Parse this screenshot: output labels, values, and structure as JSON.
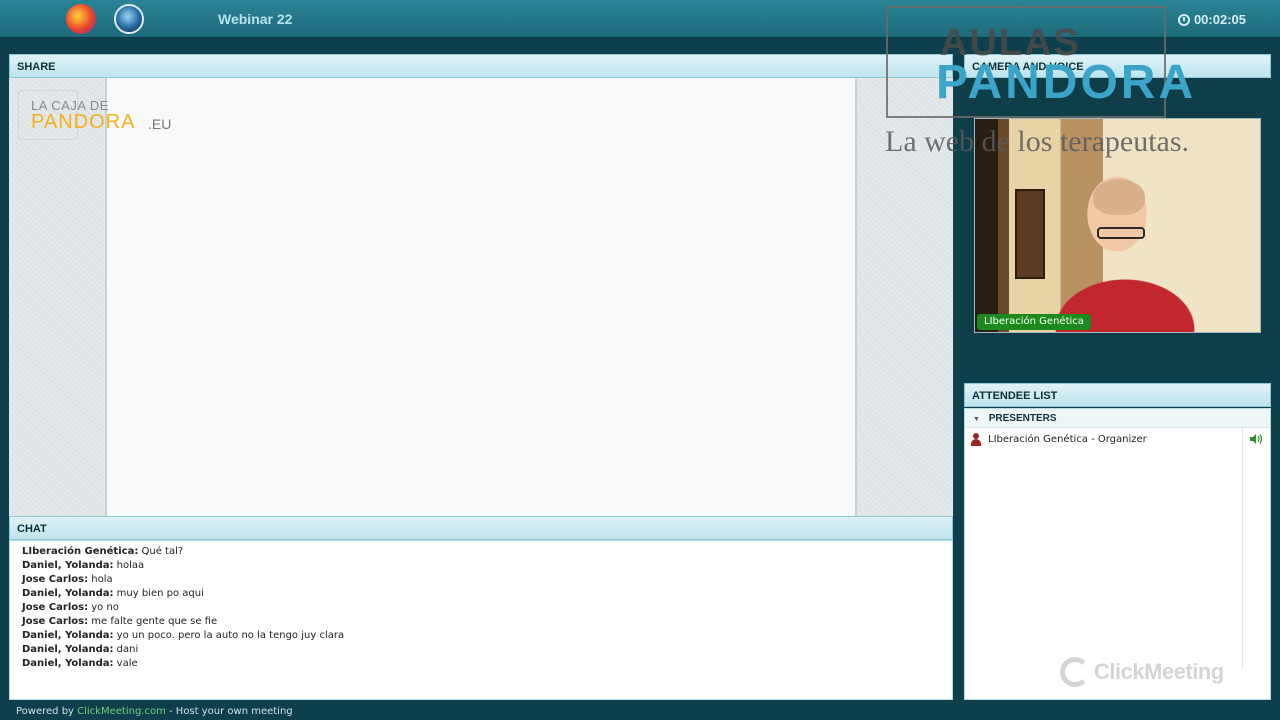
{
  "topbar": {
    "title": "Webinar 22",
    "timer": "00:02:05",
    "icons": [
      "app-logo-icon",
      "globe-icon",
      "clock-icon"
    ]
  },
  "share": {
    "header": "SHARE",
    "logo": {
      "line1": "LA CAJA DE",
      "line2": "PANDORA",
      "suffix": ".EU"
    }
  },
  "camera": {
    "header": "CAMERA AND VOICE",
    "participant_name": "LIberación Genética"
  },
  "watermark": {
    "top": "AULAS",
    "brand": "PANDORA",
    "tagline": "La web de los terapeutas."
  },
  "chat": {
    "header": "CHAT",
    "messages": [
      {
        "who": "LIberación Genética:",
        "text": " Qué tal?"
      },
      {
        "who": "Daniel, Yolanda:",
        "text": " holaa"
      },
      {
        "who": "Jose Carlos:",
        "text": " hola"
      },
      {
        "who": "Daniel, Yolanda:",
        "text": " muy bien po aqui"
      },
      {
        "who": "Jose Carlos:",
        "text": " yo no"
      },
      {
        "who": "Jose Carlos:",
        "text": " me falte gente que se fie"
      },
      {
        "who": "Daniel, Yolanda:",
        "text": " yo un poco. pero la auto no la tengo juy clara"
      },
      {
        "who": "Daniel, Yolanda:",
        "text": " dani"
      },
      {
        "who": "Daniel, Yolanda:",
        "text": " vale"
      }
    ]
  },
  "attendees": {
    "header": "ATTENDEE LIST",
    "group": "PRESENTERS",
    "list": [
      {
        "name": "LIberación Genética - Organizer"
      }
    ],
    "brand": "ClickMeeting"
  },
  "footer": {
    "prefix": "Powered by ",
    "link": "ClickMeeting.com",
    "suffix": " - Host your own meeting"
  },
  "colors": {
    "background": "#0e3f4c",
    "topbar": "#1d6b7b",
    "panel_header": "#bfe4ec",
    "name_tag": "#1c8a1c",
    "brand_blue": "#3aa4c9",
    "brand_yellow": "#f3b21b"
  }
}
